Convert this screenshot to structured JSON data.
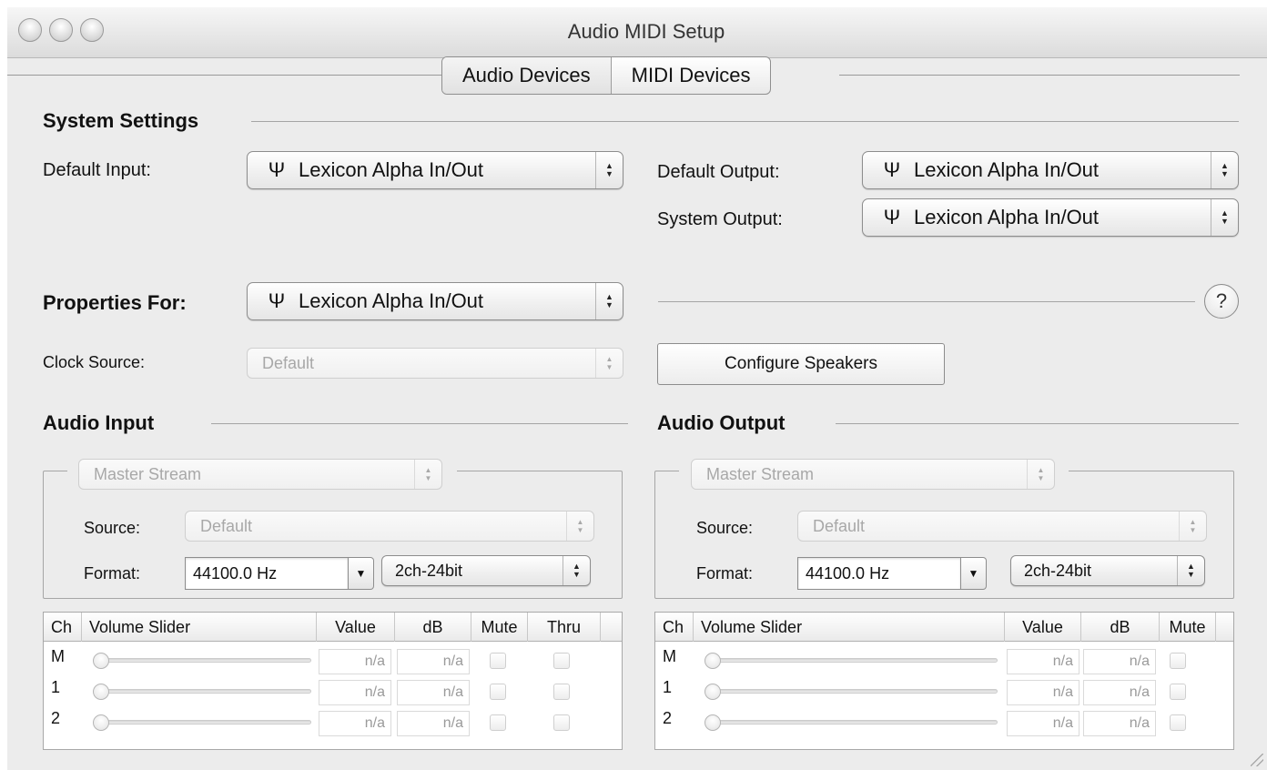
{
  "window": {
    "title": "Audio MIDI Setup"
  },
  "tabs": [
    {
      "label": "Audio Devices",
      "active": true
    },
    {
      "label": "MIDI Devices",
      "active": false
    }
  ],
  "system_settings": {
    "heading": "System Settings",
    "default_input_label": "Default Input:",
    "default_input_value": "Lexicon Alpha In/Out",
    "default_output_label": "Default Output:",
    "default_output_value": "Lexicon Alpha In/Out",
    "system_output_label": "System Output:",
    "system_output_value": "Lexicon Alpha In/Out"
  },
  "properties": {
    "label": "Properties For:",
    "value": "Lexicon Alpha In/Out",
    "help": "?",
    "clock_source_label": "Clock Source:",
    "clock_source_value": "Default",
    "configure_speakers_label": "Configure Speakers"
  },
  "audio_input": {
    "heading": "Audio Input",
    "stream": "Master Stream",
    "source_label": "Source:",
    "source_value": "Default",
    "format_label": "Format:",
    "rate": "44100.0 Hz",
    "bits": "2ch-24bit",
    "columns": [
      "Ch",
      "Volume Slider",
      "Value",
      "dB",
      "Mute",
      "Thru"
    ],
    "rows": [
      {
        "ch": "M",
        "value": "n/a",
        "db": "n/a"
      },
      {
        "ch": "1",
        "value": "n/a",
        "db": "n/a"
      },
      {
        "ch": "2",
        "value": "n/a",
        "db": "n/a"
      }
    ]
  },
  "audio_output": {
    "heading": "Audio Output",
    "stream": "Master Stream",
    "source_label": "Source:",
    "source_value": "Default",
    "format_label": "Format:",
    "rate": "44100.0 Hz",
    "bits": "2ch-24bit",
    "columns": [
      "Ch",
      "Volume Slider",
      "Value",
      "dB",
      "Mute"
    ],
    "rows": [
      {
        "ch": "M",
        "value": "n/a",
        "db": "n/a"
      },
      {
        "ch": "1",
        "value": "n/a",
        "db": "n/a"
      },
      {
        "ch": "2",
        "value": "n/a",
        "db": "n/a"
      }
    ]
  },
  "icons": {
    "usb": "usb-icon",
    "popup_arrows": "up-down-arrows-icon",
    "combo_arrow": "triangle-down-icon",
    "help": "question-icon"
  }
}
